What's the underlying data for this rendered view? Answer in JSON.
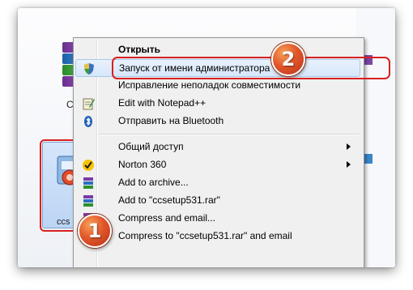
{
  "desktop": {
    "archive_label": "Сумк",
    "setup_label": "ccs"
  },
  "menu": {
    "items": [
      {
        "label": "Открыть",
        "bold": true,
        "icon": ""
      },
      {
        "label": "Запуск от имени администратора",
        "icon": "shield-icon",
        "highlighted": true
      },
      {
        "label": "Исправление неполадок совместимости",
        "icon": ""
      },
      {
        "label": "Edit with Notepad++",
        "icon": "notepad-icon"
      },
      {
        "label": "Отправить на Bluetooth",
        "icon": "bluetooth-icon"
      },
      {
        "label": "Общий доступ",
        "icon": "",
        "submenu": true
      },
      {
        "label": "Norton 360",
        "icon": "norton-check-icon",
        "submenu": true
      },
      {
        "label": "Add to archive...",
        "icon": "winrar-icon"
      },
      {
        "label": "Add to \"ccsetup531.rar\"",
        "icon": "winrar-icon"
      },
      {
        "label": "Compress and email...",
        "icon": "winrar-icon"
      },
      {
        "label": "Compress to \"ccsetup531.rar\" and email",
        "icon": "winrar-icon"
      }
    ]
  },
  "badges": {
    "one": "1",
    "two": "2"
  },
  "colors": {
    "highlight_border": "#d82020",
    "badge_orange": "#e2572a",
    "menu_bg": "#f0f0f0"
  }
}
